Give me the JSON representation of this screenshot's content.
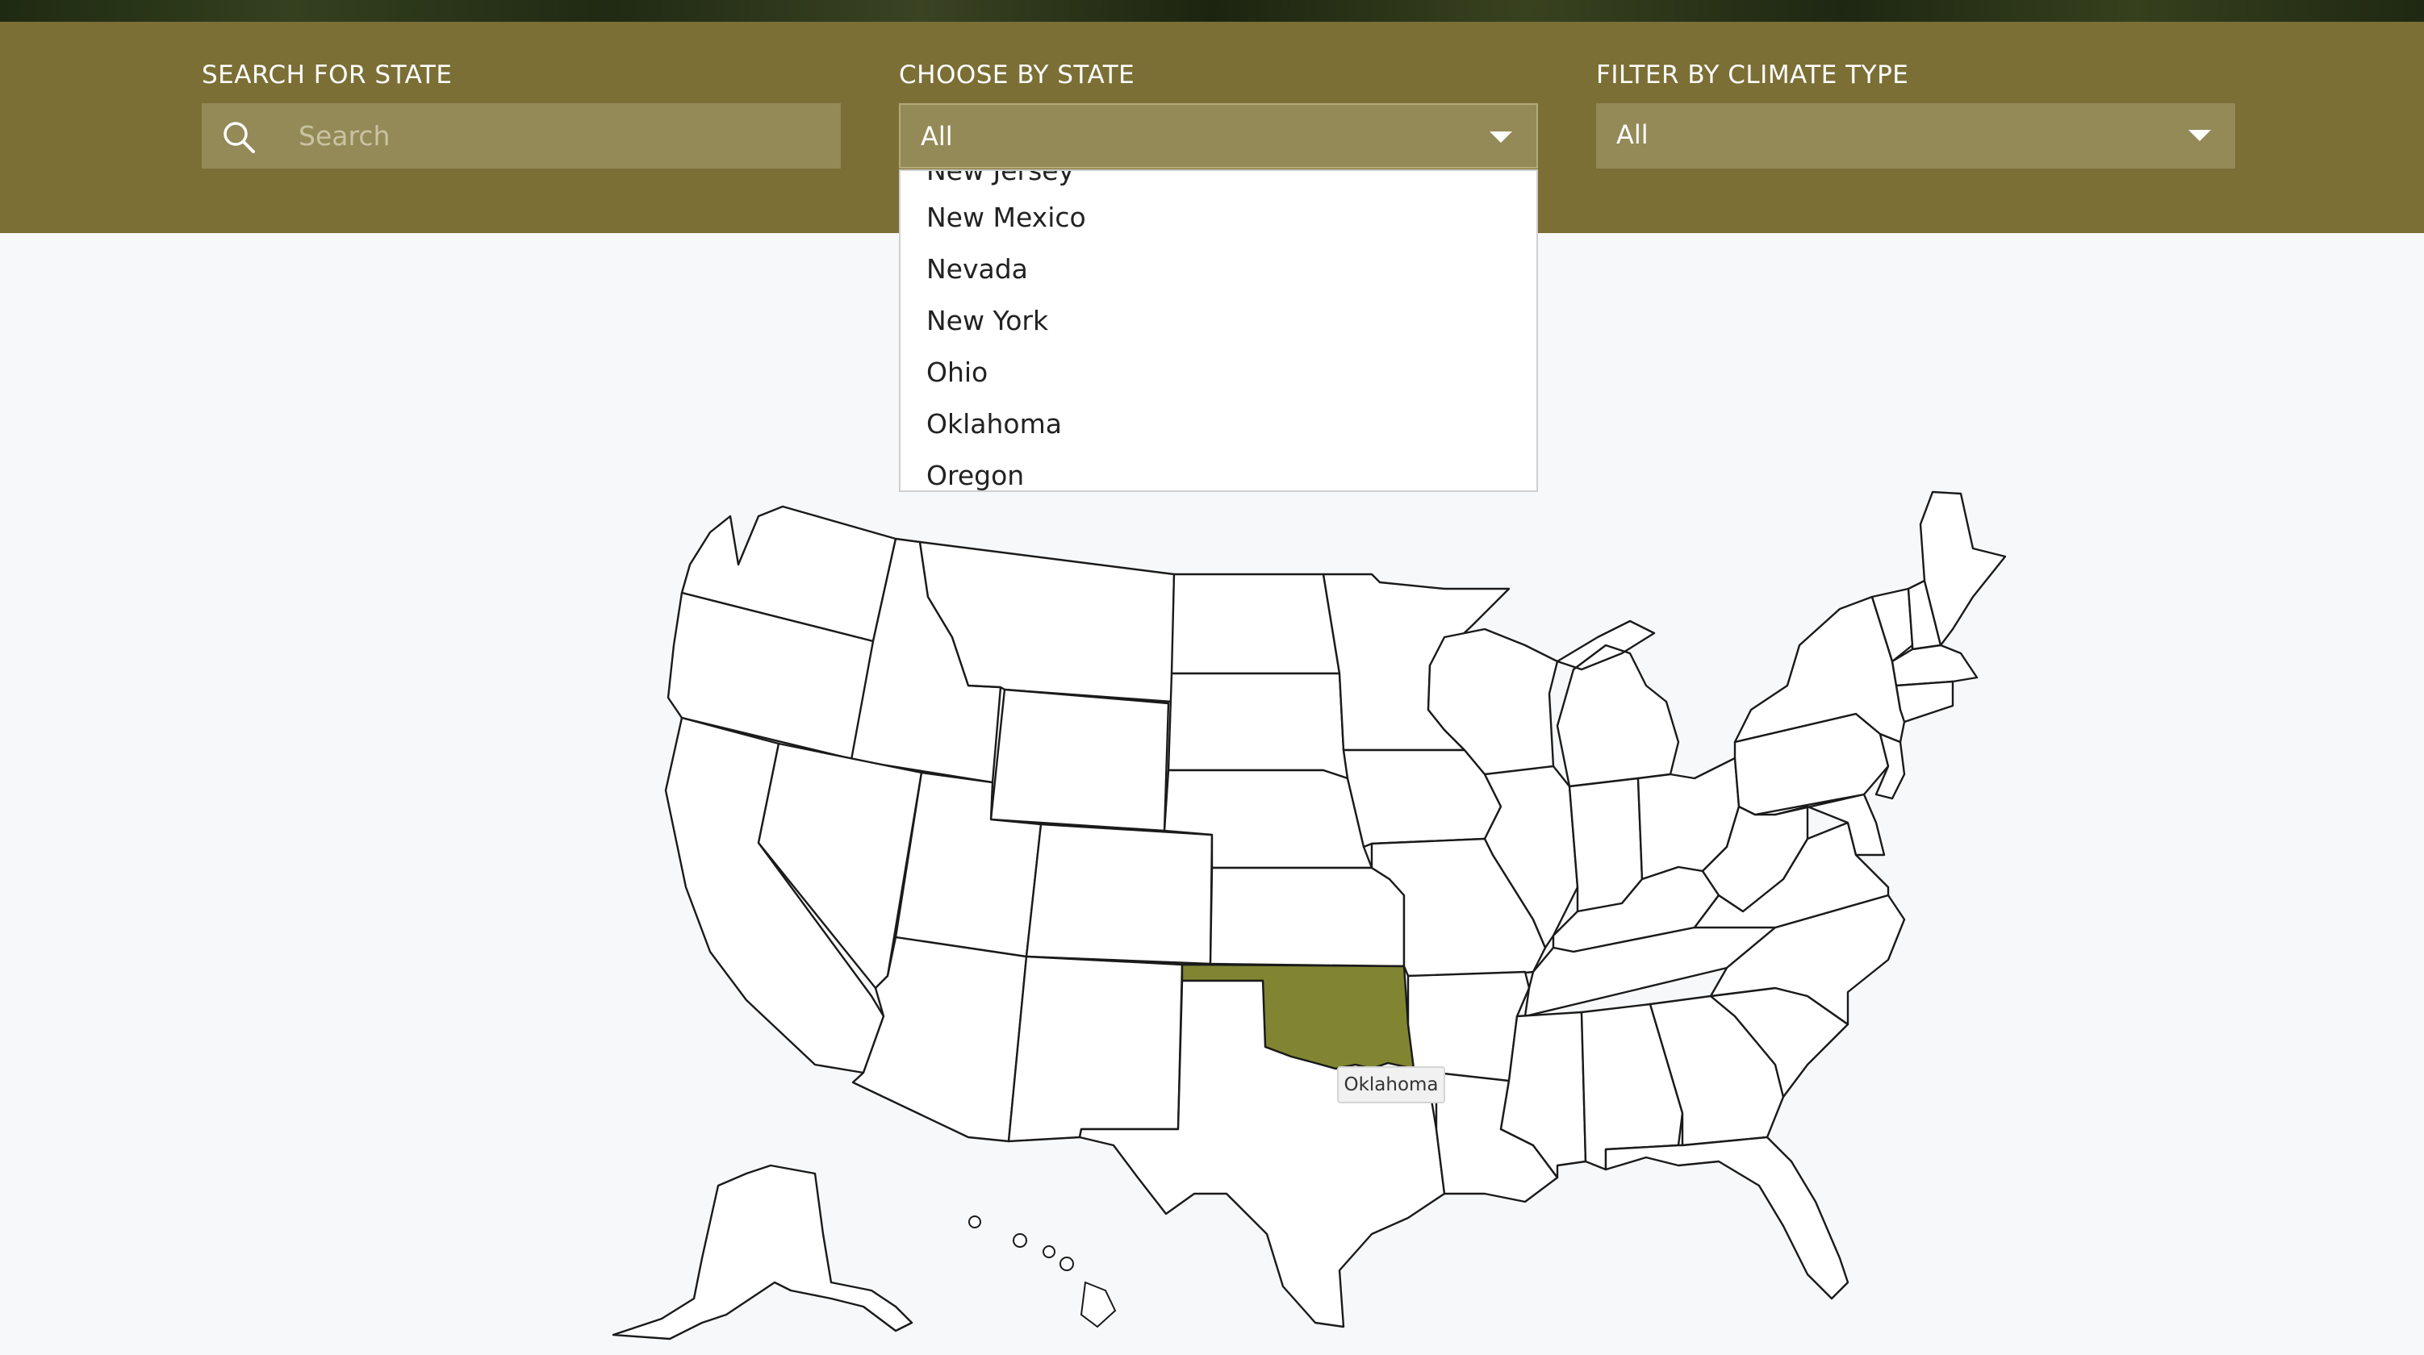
{
  "filters": {
    "search": {
      "label": "SEARCH FOR STATE",
      "placeholder": "Search",
      "value": ""
    },
    "state": {
      "label": "CHOOSE BY STATE",
      "selected": "All",
      "visible_options": [
        "New Jersey",
        "New Mexico",
        "Nevada",
        "New York",
        "Ohio",
        "Oklahoma",
        "Oregon"
      ]
    },
    "climate": {
      "label": "FILTER BY CLIMATE TYPE",
      "selected": "All"
    }
  },
  "map": {
    "highlighted_state": "Oklahoma",
    "tooltip": "Oklahoma"
  },
  "colors": {
    "filter_bar": "#7b6f36",
    "field": "#948a58",
    "highlight": "#818532",
    "background": "#f7f8f9"
  },
  "icons": {
    "search": "search-icon",
    "dropdown": "chevron-down-icon"
  }
}
